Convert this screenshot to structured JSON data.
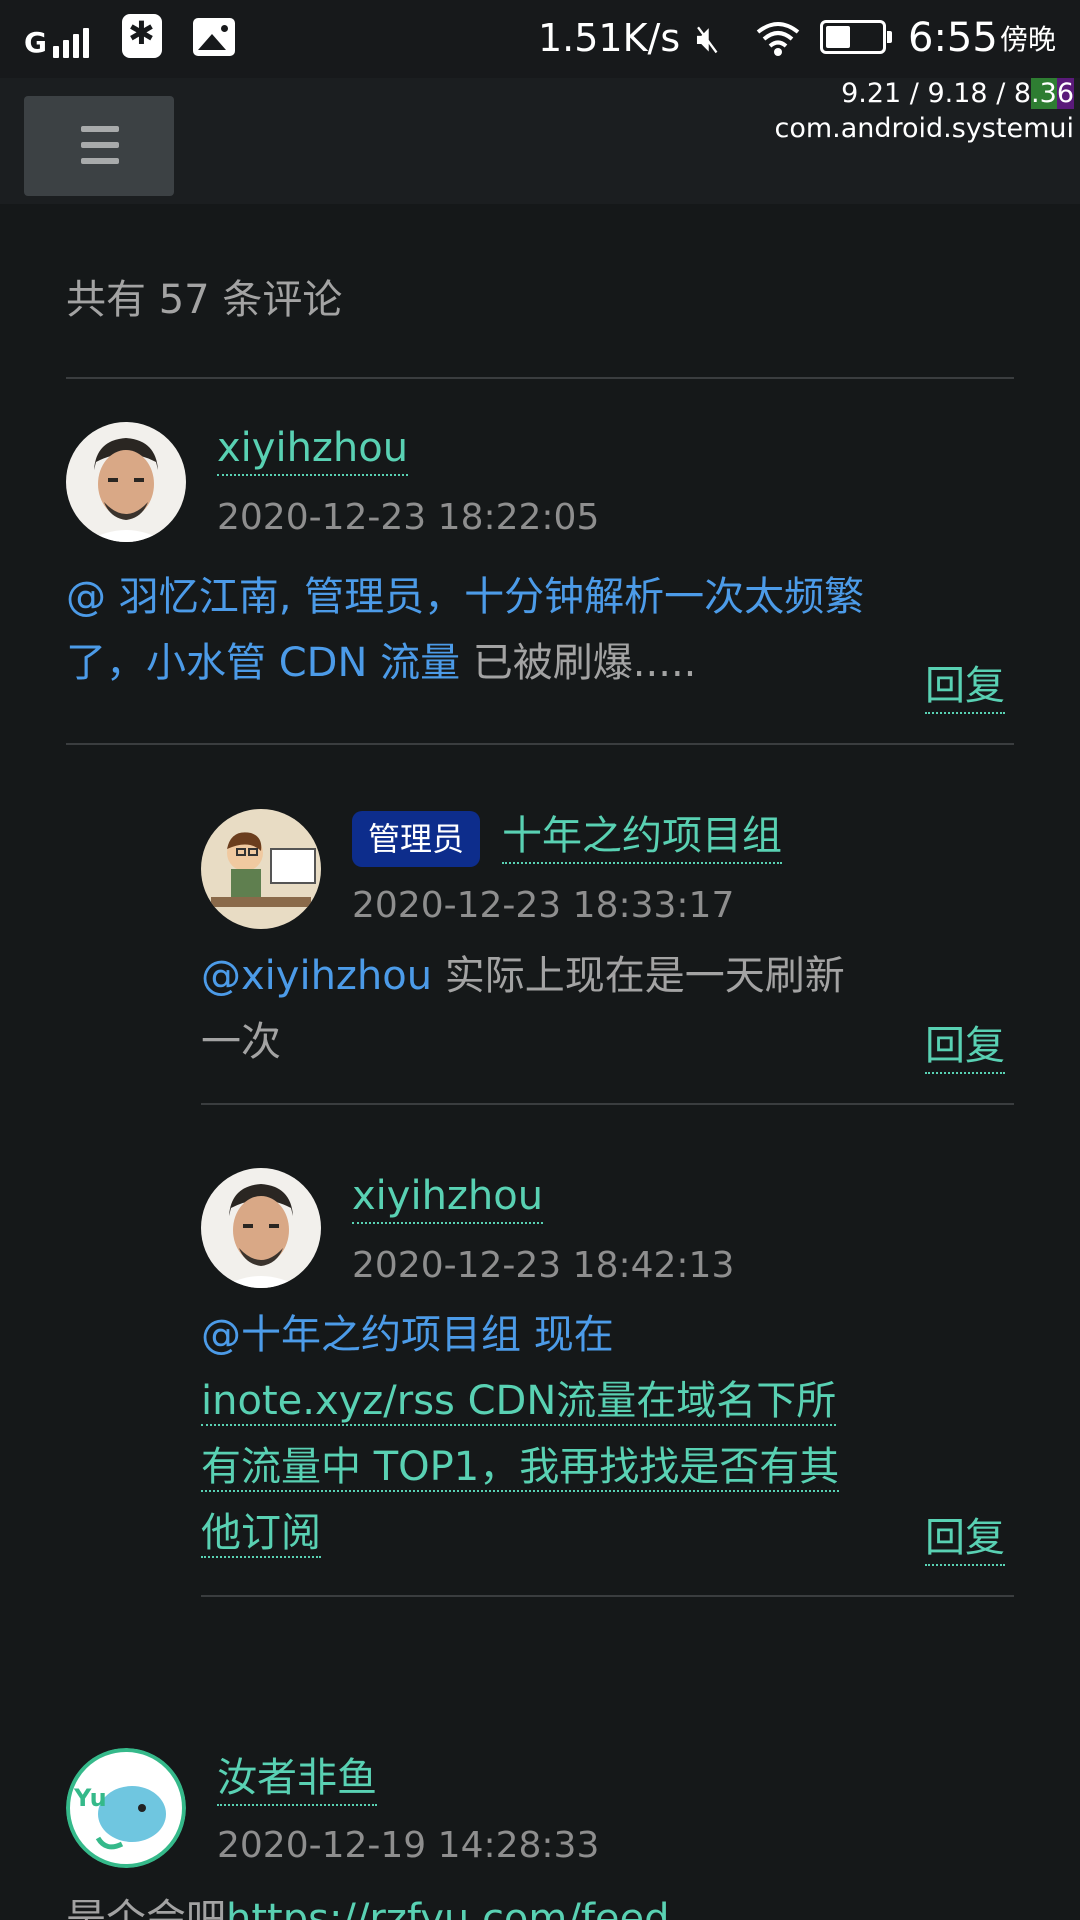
{
  "status_bar": {
    "signal": "G",
    "network_speed": "1.51K/s",
    "time": "6:55",
    "ampm": "傍晚",
    "icons": [
      "signal-icon",
      "app-notification-icon",
      "gallery-icon",
      "mute-icon",
      "wifi-icon",
      "battery-icon"
    ]
  },
  "overlay": {
    "line1_a": "9.21 / 9.18 / 8",
    "line1_b": ".3",
    "line1_c": "6",
    "line2": "com.android.systemui"
  },
  "header": {
    "menu_icon": "hamburger-menu-icon"
  },
  "comments_count": "共有 57 条评论",
  "comments": [
    {
      "author": "xiyihzhou",
      "time": "2020-12-23 18:22:05",
      "body_mention": "@ ",
      "body_blue": "羽忆江南, 管理员，十分钟解析一次太频繁了，小水管 CDN 流量",
      "body_rest": " 已被刷爆.....",
      "reply": "回复"
    },
    {
      "badge": "管理员",
      "author": "十年之约项目组",
      "time": "2020-12-23 18:33:17",
      "body_mention": "@xiyihzhou",
      "body_rest": " 实际上现在是一天刷新一次",
      "reply": "回复"
    },
    {
      "author": "xiyihzhou",
      "time": "2020-12-23 18:42:13",
      "body_mention": "@十年之约项目组 现在 ",
      "body_link": "inote.xyz/rss CDN流量在域名下所有流量中 TOP1，我再找找是否有其他订阅",
      "reply": "回复"
    },
    {
      "author": "汝者非鱼",
      "time": "2020-12-19 14:28:33",
      "body_rest": "是个会吧",
      "body_link": "https://rzfyu.com/feed"
    }
  ],
  "colors": {
    "background": "#151819",
    "accent_green": "#59d1b3",
    "mention_blue": "#4c9be8",
    "badge_blue": "#0d2d8c"
  }
}
